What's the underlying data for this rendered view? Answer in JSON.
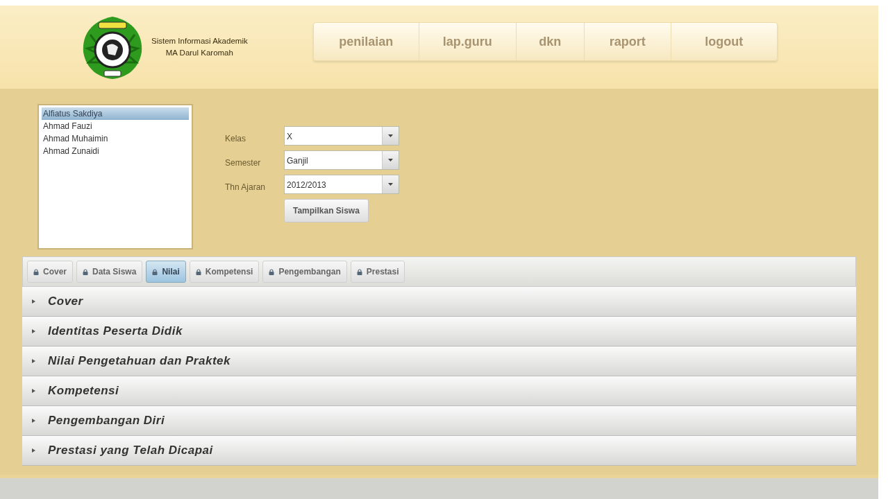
{
  "header": {
    "title_line_1": "Sistem Informasi Akademik",
    "title_line_2": "MA Darul Karomah"
  },
  "nav": [
    {
      "label": "penilaian"
    },
    {
      "label": "lap.guru"
    },
    {
      "label": "dkn"
    },
    {
      "label": "raport"
    },
    {
      "label": "logout"
    }
  ],
  "students": [
    {
      "name": "Alfiatus Sakdiya",
      "selected": true
    },
    {
      "name": "Ahmad Fauzi",
      "selected": false
    },
    {
      "name": "Ahmad Muhaimin",
      "selected": false
    },
    {
      "name": "Ahmad Zunaidi",
      "selected": false
    }
  ],
  "filters": [
    {
      "label": "Kelas",
      "value": "X"
    },
    {
      "label": "Semester",
      "value": "Ganjil"
    },
    {
      "label": "Thn Ajaran",
      "value": "2012/2013"
    }
  ],
  "show_button": "Tampilkan Siswa",
  "tabs": [
    {
      "label": "Cover",
      "selected": false
    },
    {
      "label": "Data Siswa",
      "selected": false
    },
    {
      "label": "Nilai",
      "selected": true
    },
    {
      "label": "Kompetensi",
      "selected": false
    },
    {
      "label": "Pengembangan",
      "selected": false
    },
    {
      "label": "Prestasi",
      "selected": false
    }
  ],
  "sections": [
    {
      "title": "Cover",
      "expanded": false
    },
    {
      "title": "Identitas Peserta Didik",
      "expanded": false
    },
    {
      "title": "Nilai Pengetahuan dan Praktek",
      "expanded": false
    },
    {
      "title": "Kompetensi",
      "expanded": false
    },
    {
      "title": "Pengembangan Diri",
      "expanded": false
    },
    {
      "title": "Prestasi yang Telah Dicapai",
      "expanded": false
    }
  ]
}
